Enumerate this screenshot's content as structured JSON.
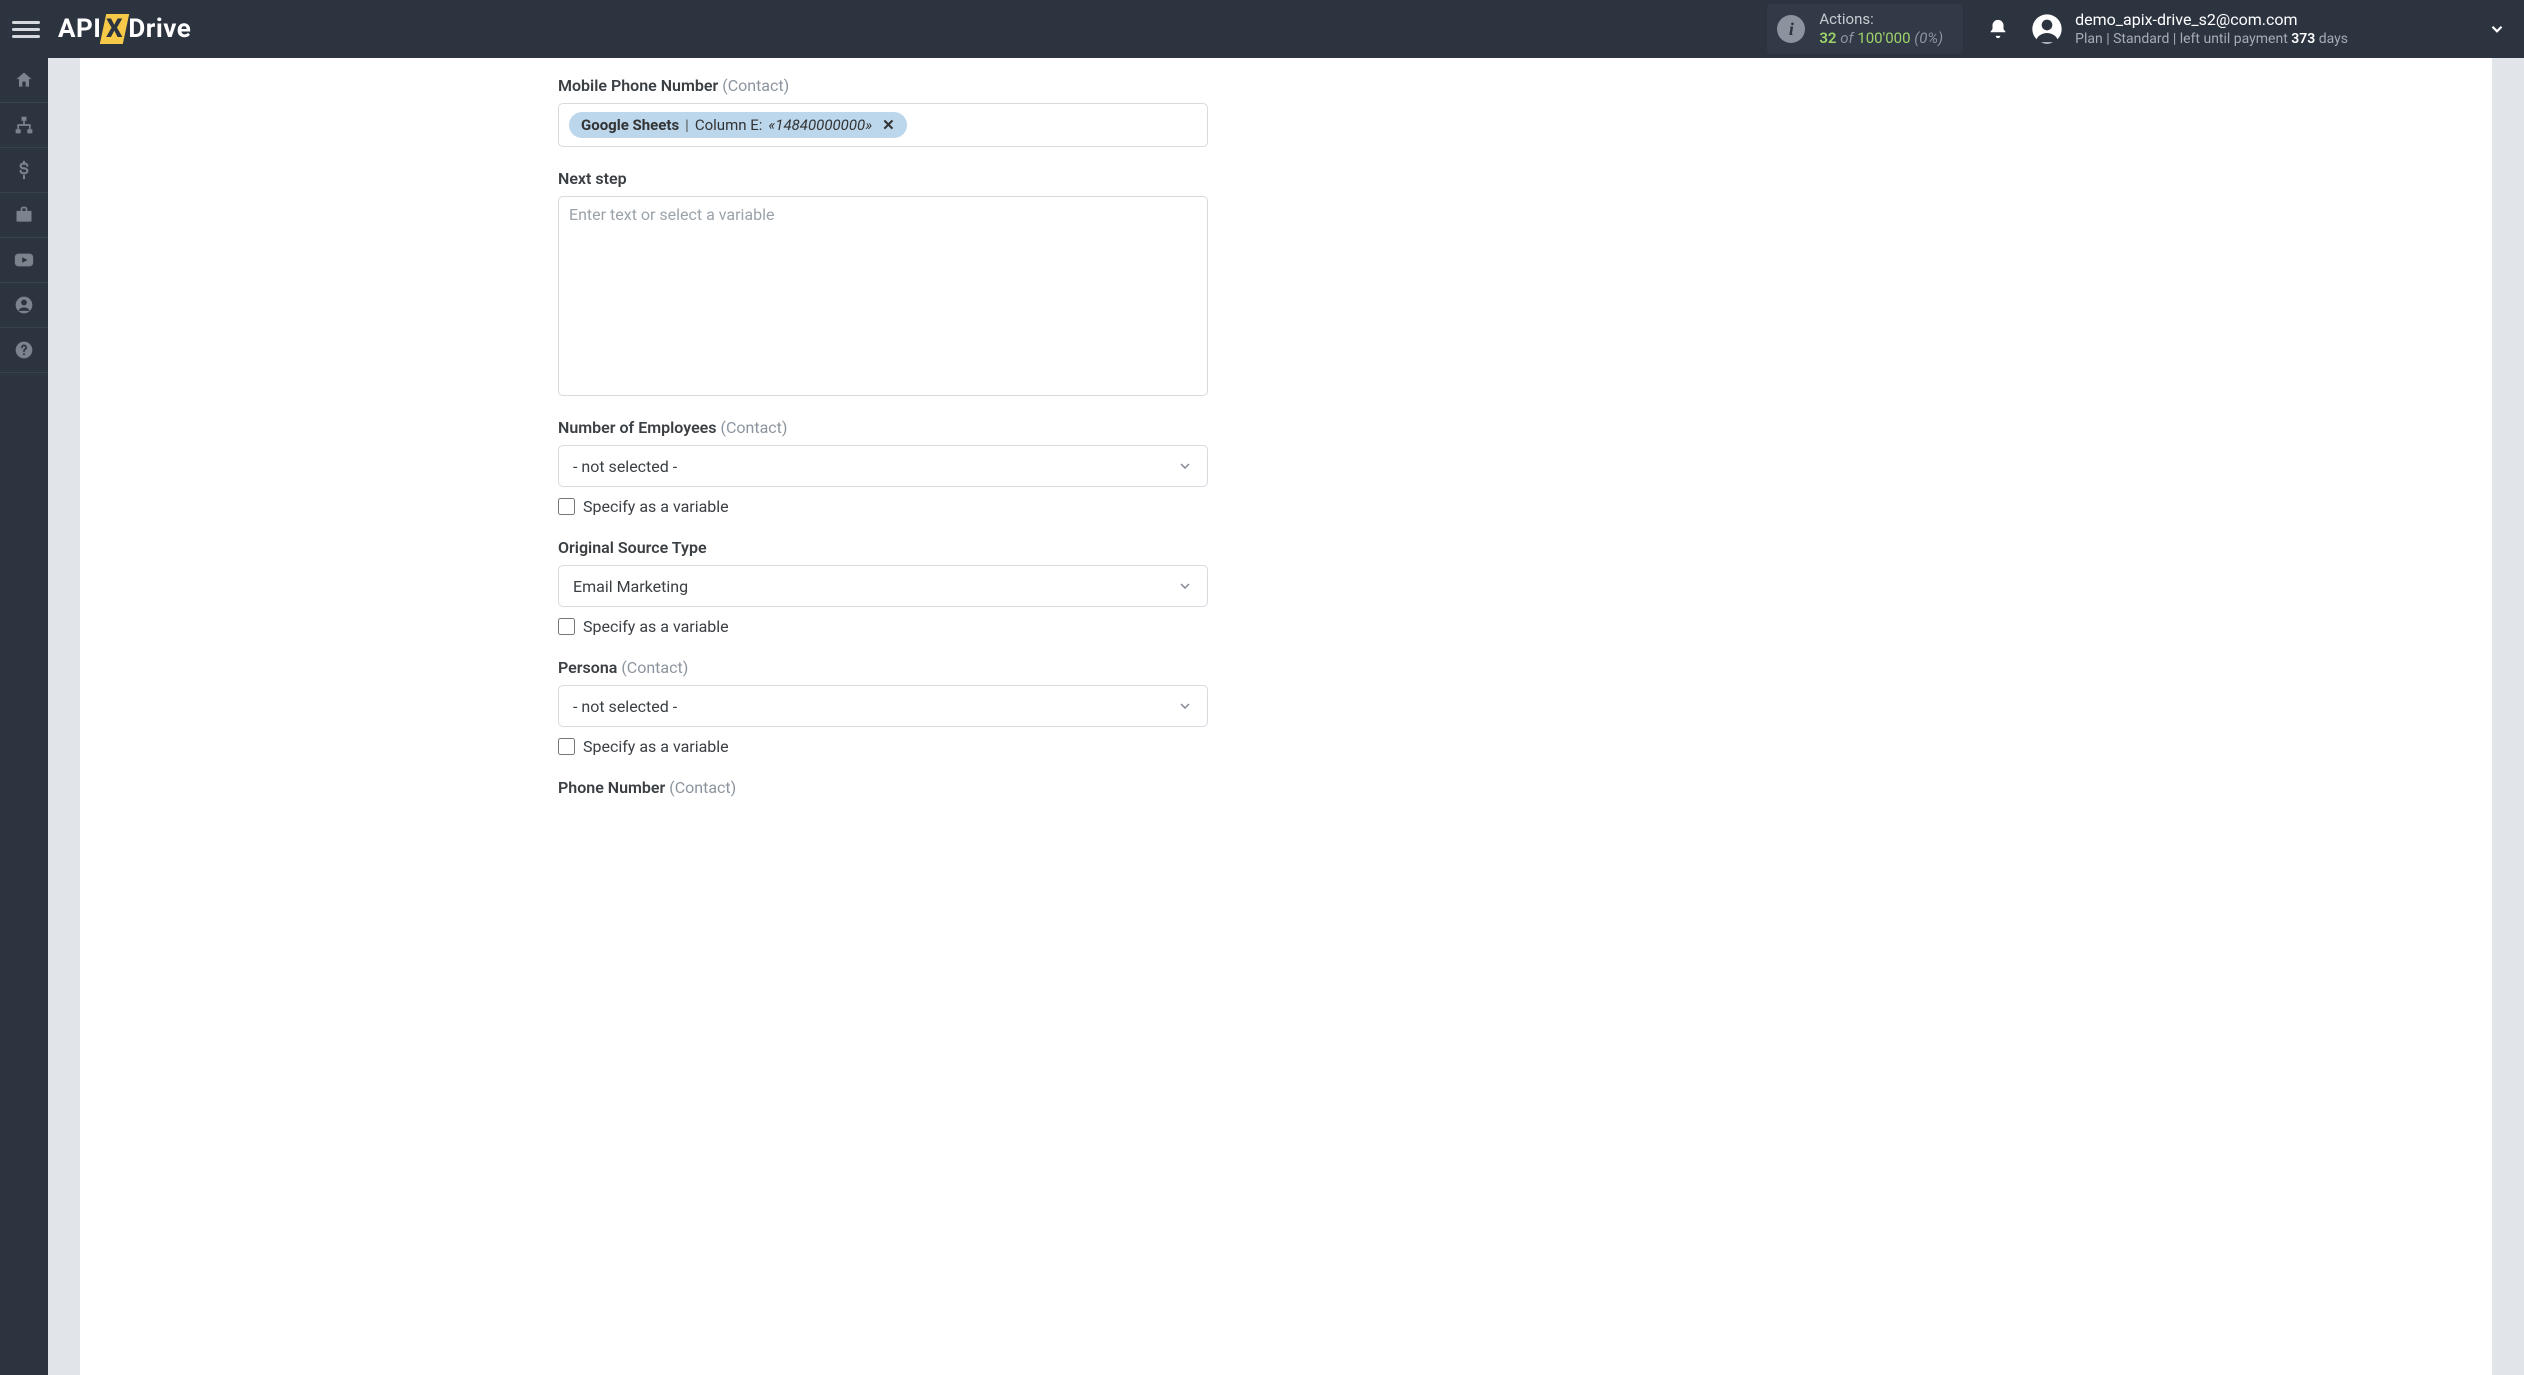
{
  "topbar": {
    "logo": {
      "part1": "API",
      "part2": "X",
      "part3": "Drive"
    },
    "actions": {
      "label": "Actions:",
      "count": "32",
      "of": "of",
      "total": "100'000",
      "percent": "(0%)"
    },
    "user": {
      "email": "demo_apix-drive_s2@com.com",
      "plan_prefix": "Plan  | ",
      "plan_name": "Standard",
      "plan_mid": " |  left until payment ",
      "days": "373",
      "plan_suffix": " days"
    }
  },
  "sidebar_icons": [
    "home",
    "sitemap",
    "dollar",
    "briefcase",
    "youtube",
    "user",
    "question"
  ],
  "fields": {
    "mobile_phone": {
      "label": "Mobile Phone Number",
      "sublabel": "(Contact)",
      "token": {
        "source": "Google Sheets",
        "separator": " | ",
        "column": "Column E: ",
        "value": "«14840000000»"
      }
    },
    "next_step": {
      "label": "Next step",
      "placeholder": "Enter text or select a variable"
    },
    "num_employees": {
      "label": "Number of Employees",
      "sublabel": "(Contact)",
      "selected": "- not selected -",
      "checkbox": "Specify as a variable"
    },
    "original_source": {
      "label": "Original Source Type",
      "selected": "Email Marketing",
      "checkbox": "Specify as a variable"
    },
    "persona": {
      "label": "Persona",
      "sublabel": "(Contact)",
      "selected": "- not selected -",
      "checkbox": "Specify as a variable"
    },
    "phone_number": {
      "label": "Phone Number",
      "sublabel": "(Contact)"
    }
  }
}
